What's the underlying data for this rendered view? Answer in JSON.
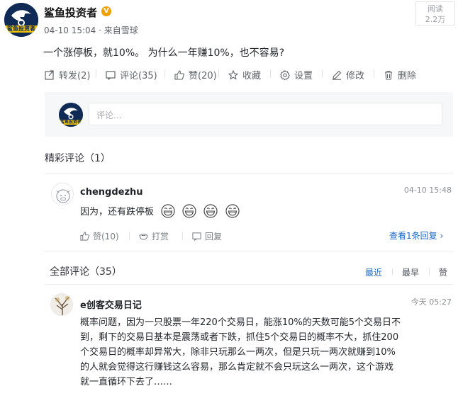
{
  "post": {
    "author": "鲨鱼投资者",
    "verified_badge": "V",
    "avatar_label": "鲨鱼投资者",
    "meta": "04-10 15:04 · 来自雪球",
    "read_label": "阅读",
    "read_count": "2.2万",
    "text": "一个涨停板，就10%。 为什么一年赚10%，也不容易?"
  },
  "actions": {
    "repost": "转发(2)",
    "comment": "评论(35)",
    "like": "赞(20)",
    "favorite": "收藏",
    "settings": "设置",
    "edit": "修改",
    "delete": "删除"
  },
  "reply": {
    "placeholder": "评论..."
  },
  "featured": {
    "title": "精彩评论（1）",
    "comment": {
      "user": "chengdezhu",
      "time": "04-10 15:48",
      "text": "因为，还有跌停板",
      "like": "赞(10)",
      "reward": "打赏",
      "reply": "回复",
      "view_replies": "查看1条回复 ›"
    }
  },
  "all_comments": {
    "title": "全部评论（35）",
    "sort": [
      "最近",
      "最早",
      "赞"
    ],
    "comments": [
      {
        "user": "e创客交易日记",
        "time": "今天 05:27",
        "lines": [
          "概率问题，因为一只股票一年220个交易日，能涨10%的天数可能5个交易日不",
          "到，剩下的交易日基本是震荡或者下跌，抓住5个交易日的概率不大，抓住200",
          "个交易日的概率却异常大，除非只玩那么一两次，但是只玩一两次就赚到10%",
          "的人就会觉得这行赚钱这么容易，那么肯定就不会只玩这么一两次，这个游戏",
          "就一直循环下去了……"
        ]
      }
    ]
  },
  "colors": {
    "link_blue": "#1a66c4",
    "avatar_navy": "#0e2a55",
    "avatar_yellow": "#f5c400",
    "badge_orange": "#f0a000"
  }
}
